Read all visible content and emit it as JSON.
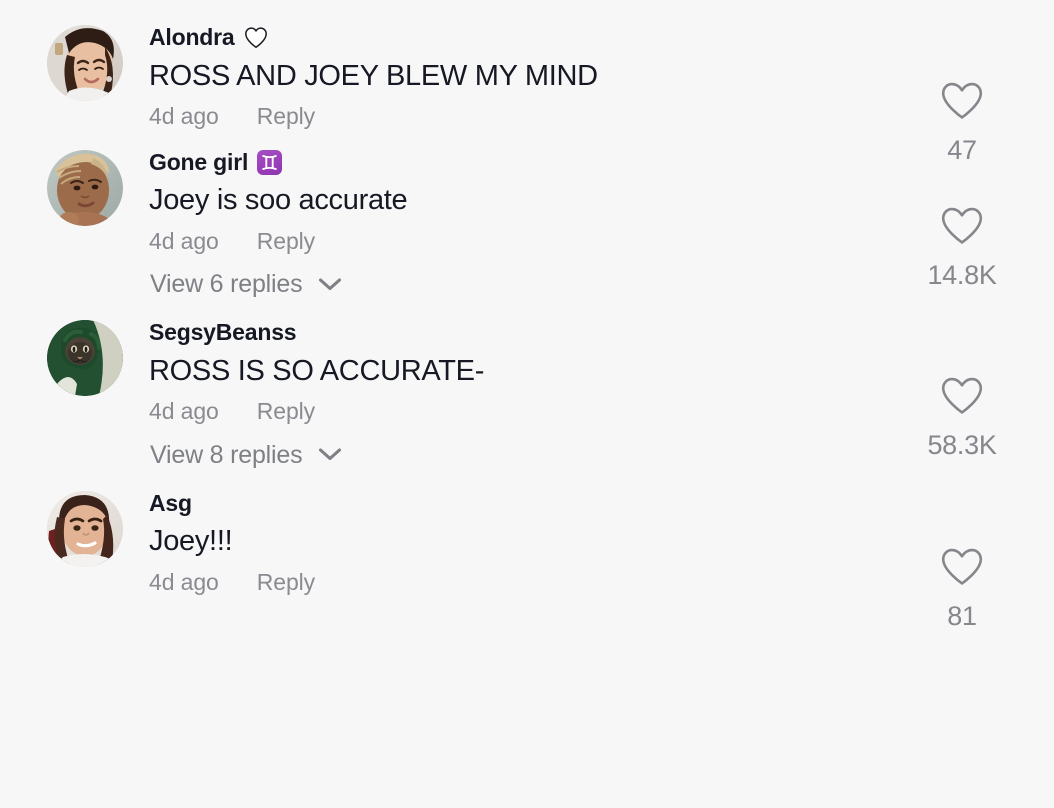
{
  "app": {
    "background_color": "#f7f7f7",
    "text_color": "#161823",
    "muted_color": "#8a8b91",
    "like_color": "#86878c"
  },
  "comments": [
    {
      "username": "Alondra",
      "badge": "white-heart-emoji",
      "text": "ROSS AND JOEY BLEW MY MIND",
      "time": "4d ago",
      "reply_label": "Reply",
      "like_count": "47",
      "like_icon": "heart-outline-icon",
      "view_replies": null,
      "avatar": "avatar-alondra"
    },
    {
      "username": "Gone girl",
      "badge": "gemini-emoji",
      "text": "Joey is soo accurate",
      "time": "4d ago",
      "reply_label": "Reply",
      "like_count": "14.8K",
      "like_icon": "heart-outline-icon",
      "view_replies": "View 6 replies",
      "avatar": "avatar-gone-girl"
    },
    {
      "username": "SegsyBeanss",
      "badge": null,
      "text": "ROSS IS SO ACCURATE-",
      "time": "4d ago",
      "reply_label": "Reply",
      "like_count": "58.3K",
      "like_icon": "heart-outline-icon",
      "view_replies": "View 8 replies",
      "avatar": "avatar-segsybeanss"
    },
    {
      "username": "Asg",
      "badge": null,
      "text": "Joey!!!",
      "time": "4d ago",
      "reply_label": "Reply",
      "like_count": "81",
      "like_icon": "heart-outline-icon",
      "view_replies": null,
      "avatar": "avatar-asg"
    }
  ]
}
